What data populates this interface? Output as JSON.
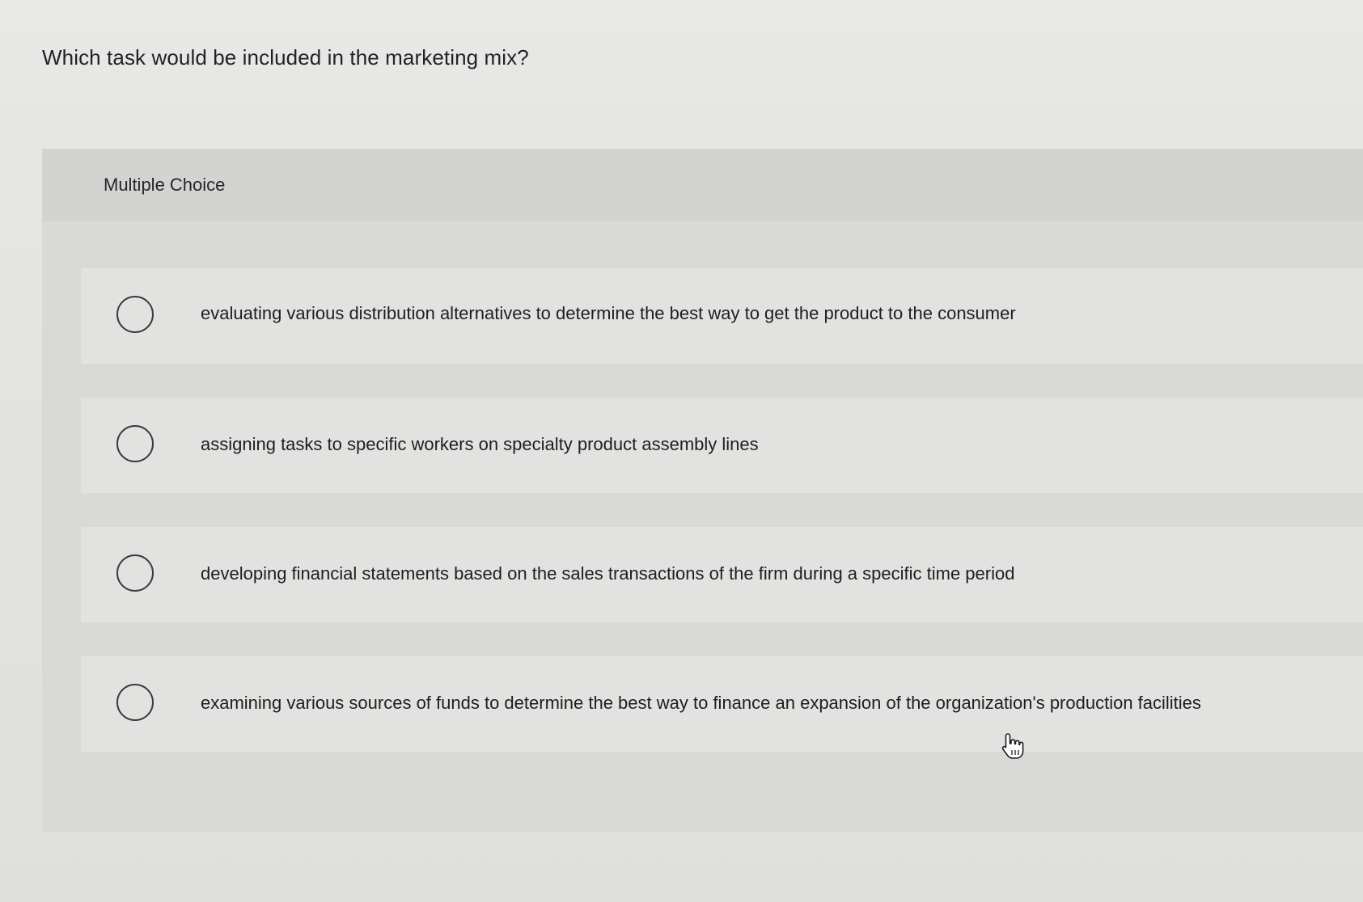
{
  "question": {
    "text": "Which task would be included in the marketing mix?"
  },
  "panel": {
    "label": "Multiple Choice"
  },
  "choices": [
    {
      "text": "evaluating various distribution alternatives to determine the best way to get the product to the consumer",
      "selected": false
    },
    {
      "text": "assigning tasks to specific workers on specialty product assembly lines",
      "selected": false
    },
    {
      "text": "developing financial statements based on the sales transactions of the firm during a specific time period",
      "selected": false
    },
    {
      "text": "examining various sources of funds to determine the best way to finance an expansion of the organization's production facilities",
      "selected": false
    }
  ],
  "cursor": {
    "icon": "hand-pointer-icon"
  }
}
